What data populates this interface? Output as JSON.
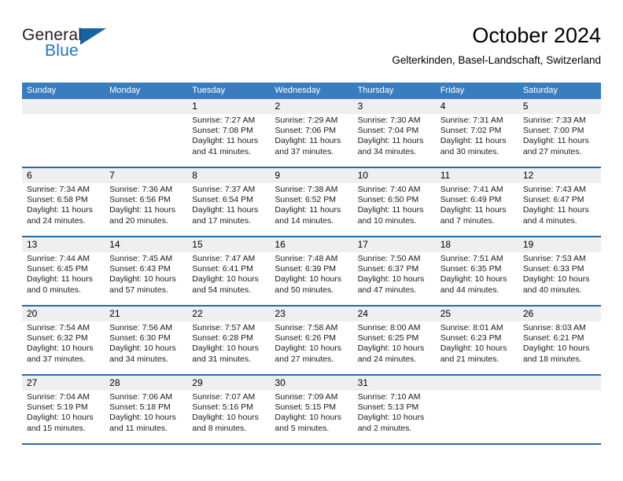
{
  "brand": {
    "name_part1": "General",
    "name_part2": "Blue",
    "accent_color": "#1464a5"
  },
  "header": {
    "title": "October 2024",
    "subtitle": "Gelterkinden, Basel-Landschaft, Switzerland"
  },
  "theme": {
    "header_row_bg": "#3a7dbf",
    "week_separator": "#2a69ad",
    "daynum_band_bg": "#efeff0"
  },
  "weekdays": [
    "Sunday",
    "Monday",
    "Tuesday",
    "Wednesday",
    "Thursday",
    "Friday",
    "Saturday"
  ],
  "weeks": [
    [
      {
        "day": "",
        "sunrise": "",
        "sunset": "",
        "daylight_a": "",
        "daylight_b": "",
        "empty": true
      },
      {
        "day": "",
        "sunrise": "",
        "sunset": "",
        "daylight_a": "",
        "daylight_b": "",
        "empty": true
      },
      {
        "day": "1",
        "sunrise": "Sunrise: 7:27 AM",
        "sunset": "Sunset: 7:08 PM",
        "daylight_a": "Daylight: 11 hours",
        "daylight_b": "and 41 minutes."
      },
      {
        "day": "2",
        "sunrise": "Sunrise: 7:29 AM",
        "sunset": "Sunset: 7:06 PM",
        "daylight_a": "Daylight: 11 hours",
        "daylight_b": "and 37 minutes."
      },
      {
        "day": "3",
        "sunrise": "Sunrise: 7:30 AM",
        "sunset": "Sunset: 7:04 PM",
        "daylight_a": "Daylight: 11 hours",
        "daylight_b": "and 34 minutes."
      },
      {
        "day": "4",
        "sunrise": "Sunrise: 7:31 AM",
        "sunset": "Sunset: 7:02 PM",
        "daylight_a": "Daylight: 11 hours",
        "daylight_b": "and 30 minutes."
      },
      {
        "day": "5",
        "sunrise": "Sunrise: 7:33 AM",
        "sunset": "Sunset: 7:00 PM",
        "daylight_a": "Daylight: 11 hours",
        "daylight_b": "and 27 minutes."
      }
    ],
    [
      {
        "day": "6",
        "sunrise": "Sunrise: 7:34 AM",
        "sunset": "Sunset: 6:58 PM",
        "daylight_a": "Daylight: 11 hours",
        "daylight_b": "and 24 minutes."
      },
      {
        "day": "7",
        "sunrise": "Sunrise: 7:36 AM",
        "sunset": "Sunset: 6:56 PM",
        "daylight_a": "Daylight: 11 hours",
        "daylight_b": "and 20 minutes."
      },
      {
        "day": "8",
        "sunrise": "Sunrise: 7:37 AM",
        "sunset": "Sunset: 6:54 PM",
        "daylight_a": "Daylight: 11 hours",
        "daylight_b": "and 17 minutes."
      },
      {
        "day": "9",
        "sunrise": "Sunrise: 7:38 AM",
        "sunset": "Sunset: 6:52 PM",
        "daylight_a": "Daylight: 11 hours",
        "daylight_b": "and 14 minutes."
      },
      {
        "day": "10",
        "sunrise": "Sunrise: 7:40 AM",
        "sunset": "Sunset: 6:50 PM",
        "daylight_a": "Daylight: 11 hours",
        "daylight_b": "and 10 minutes."
      },
      {
        "day": "11",
        "sunrise": "Sunrise: 7:41 AM",
        "sunset": "Sunset: 6:49 PM",
        "daylight_a": "Daylight: 11 hours",
        "daylight_b": "and 7 minutes."
      },
      {
        "day": "12",
        "sunrise": "Sunrise: 7:43 AM",
        "sunset": "Sunset: 6:47 PM",
        "daylight_a": "Daylight: 11 hours",
        "daylight_b": "and 4 minutes."
      }
    ],
    [
      {
        "day": "13",
        "sunrise": "Sunrise: 7:44 AM",
        "sunset": "Sunset: 6:45 PM",
        "daylight_a": "Daylight: 11 hours",
        "daylight_b": "and 0 minutes."
      },
      {
        "day": "14",
        "sunrise": "Sunrise: 7:45 AM",
        "sunset": "Sunset: 6:43 PM",
        "daylight_a": "Daylight: 10 hours",
        "daylight_b": "and 57 minutes."
      },
      {
        "day": "15",
        "sunrise": "Sunrise: 7:47 AM",
        "sunset": "Sunset: 6:41 PM",
        "daylight_a": "Daylight: 10 hours",
        "daylight_b": "and 54 minutes."
      },
      {
        "day": "16",
        "sunrise": "Sunrise: 7:48 AM",
        "sunset": "Sunset: 6:39 PM",
        "daylight_a": "Daylight: 10 hours",
        "daylight_b": "and 50 minutes."
      },
      {
        "day": "17",
        "sunrise": "Sunrise: 7:50 AM",
        "sunset": "Sunset: 6:37 PM",
        "daylight_a": "Daylight: 10 hours",
        "daylight_b": "and 47 minutes."
      },
      {
        "day": "18",
        "sunrise": "Sunrise: 7:51 AM",
        "sunset": "Sunset: 6:35 PM",
        "daylight_a": "Daylight: 10 hours",
        "daylight_b": "and 44 minutes."
      },
      {
        "day": "19",
        "sunrise": "Sunrise: 7:53 AM",
        "sunset": "Sunset: 6:33 PM",
        "daylight_a": "Daylight: 10 hours",
        "daylight_b": "and 40 minutes."
      }
    ],
    [
      {
        "day": "20",
        "sunrise": "Sunrise: 7:54 AM",
        "sunset": "Sunset: 6:32 PM",
        "daylight_a": "Daylight: 10 hours",
        "daylight_b": "and 37 minutes."
      },
      {
        "day": "21",
        "sunrise": "Sunrise: 7:56 AM",
        "sunset": "Sunset: 6:30 PM",
        "daylight_a": "Daylight: 10 hours",
        "daylight_b": "and 34 minutes."
      },
      {
        "day": "22",
        "sunrise": "Sunrise: 7:57 AM",
        "sunset": "Sunset: 6:28 PM",
        "daylight_a": "Daylight: 10 hours",
        "daylight_b": "and 31 minutes."
      },
      {
        "day": "23",
        "sunrise": "Sunrise: 7:58 AM",
        "sunset": "Sunset: 6:26 PM",
        "daylight_a": "Daylight: 10 hours",
        "daylight_b": "and 27 minutes."
      },
      {
        "day": "24",
        "sunrise": "Sunrise: 8:00 AM",
        "sunset": "Sunset: 6:25 PM",
        "daylight_a": "Daylight: 10 hours",
        "daylight_b": "and 24 minutes."
      },
      {
        "day": "25",
        "sunrise": "Sunrise: 8:01 AM",
        "sunset": "Sunset: 6:23 PM",
        "daylight_a": "Daylight: 10 hours",
        "daylight_b": "and 21 minutes."
      },
      {
        "day": "26",
        "sunrise": "Sunrise: 8:03 AM",
        "sunset": "Sunset: 6:21 PM",
        "daylight_a": "Daylight: 10 hours",
        "daylight_b": "and 18 minutes."
      }
    ],
    [
      {
        "day": "27",
        "sunrise": "Sunrise: 7:04 AM",
        "sunset": "Sunset: 5:19 PM",
        "daylight_a": "Daylight: 10 hours",
        "daylight_b": "and 15 minutes."
      },
      {
        "day": "28",
        "sunrise": "Sunrise: 7:06 AM",
        "sunset": "Sunset: 5:18 PM",
        "daylight_a": "Daylight: 10 hours",
        "daylight_b": "and 11 minutes."
      },
      {
        "day": "29",
        "sunrise": "Sunrise: 7:07 AM",
        "sunset": "Sunset: 5:16 PM",
        "daylight_a": "Daylight: 10 hours",
        "daylight_b": "and 8 minutes."
      },
      {
        "day": "30",
        "sunrise": "Sunrise: 7:09 AM",
        "sunset": "Sunset: 5:15 PM",
        "daylight_a": "Daylight: 10 hours",
        "daylight_b": "and 5 minutes."
      },
      {
        "day": "31",
        "sunrise": "Sunrise: 7:10 AM",
        "sunset": "Sunset: 5:13 PM",
        "daylight_a": "Daylight: 10 hours",
        "daylight_b": "and 2 minutes."
      },
      {
        "day": "",
        "sunrise": "",
        "sunset": "",
        "daylight_a": "",
        "daylight_b": "",
        "empty": true
      },
      {
        "day": "",
        "sunrise": "",
        "sunset": "",
        "daylight_a": "",
        "daylight_b": "",
        "empty": true
      }
    ]
  ]
}
